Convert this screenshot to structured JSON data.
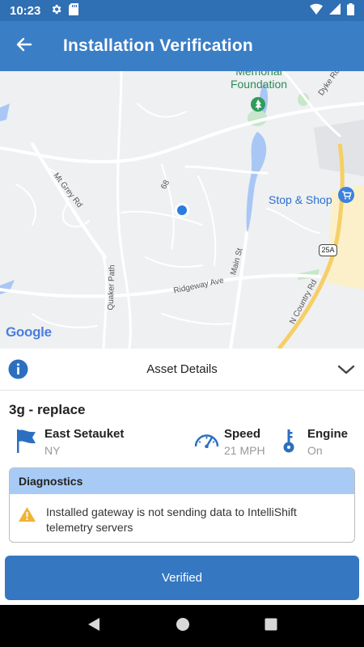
{
  "status_bar": {
    "time": "10:23",
    "icons": [
      "gear-icon",
      "sd-card-icon",
      "wifi-icon",
      "signal-icon",
      "battery-icon"
    ]
  },
  "app_bar": {
    "title": "Installation Verification",
    "back_icon": "arrow-left-icon"
  },
  "map": {
    "attribution": "Google",
    "labels": {
      "memorial_foundation": "Memorial Foundation",
      "dyke_rd": "Dyke Rd",
      "mt_grey_rd": "Mt Grey Rd",
      "road_68": "68",
      "stop_shop": "Stop & Shop",
      "main_st": "Main St",
      "quaker_path": "Quaker Path",
      "ridgeway_ave": "Ridgeway Ave",
      "route_25a": "25A",
      "n_country_rd": "N Country Rd"
    }
  },
  "asset_details": {
    "header": "Asset Details",
    "vehicle_name": "3g - replace",
    "location": {
      "city": "East Setauket",
      "state": "NY"
    },
    "speed": {
      "label": "Speed",
      "value": "21 MPH"
    },
    "engine": {
      "label": "Engine",
      "value": "On"
    }
  },
  "diagnostics": {
    "title": "Diagnostics",
    "message": "Installed gateway is not sending data to IntelliShift telemetry servers"
  },
  "actions": {
    "verified_label": "Verified"
  },
  "colors": {
    "status_bar": "#2f6fb3",
    "app_bar": "#3a7ec6",
    "accent": "#3577c1",
    "diag_header": "#a8cbf6",
    "warning": "#f2b233"
  }
}
